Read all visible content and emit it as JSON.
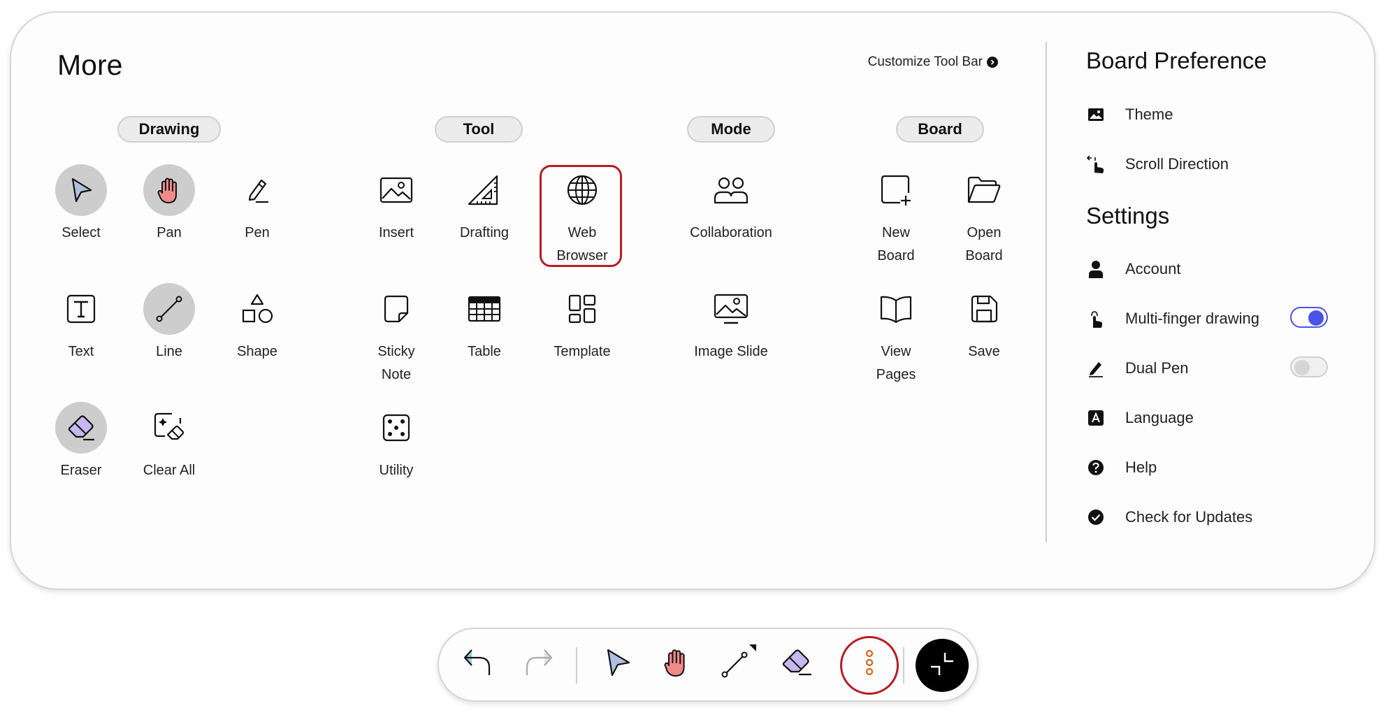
{
  "more_panel": {
    "title": "More",
    "customize_label": "Customize Tool Bar",
    "groups": {
      "drawing": "Drawing",
      "tool": "Tool",
      "mode": "Mode",
      "board": "Board"
    },
    "tools": {
      "select": "Select",
      "pan": "Pan",
      "pen": "Pen",
      "text": "Text",
      "line": "Line",
      "shape": "Shape",
      "eraser": "Eraser",
      "clear_all": "Clear All",
      "insert": "Insert",
      "drafting": "Drafting",
      "web_browser_1": "Web",
      "web_browser_2": "Browser",
      "sticky_note_1": "Sticky",
      "sticky_note_2": "Note",
      "table": "Table",
      "template": "Template",
      "utility": "Utility",
      "collaboration": "Collaboration",
      "image_slide": "Image Slide",
      "new_board_1": "New",
      "new_board_2": "Board",
      "open_board_1": "Open",
      "open_board_2": "Board",
      "view_pages_1": "View",
      "view_pages_2": "Pages",
      "save": "Save"
    },
    "selected_tools": [
      "select",
      "pan",
      "line",
      "eraser"
    ],
    "highlighted_tool": "web-browser"
  },
  "side_panel": {
    "board_preference_title": "Board Preference",
    "theme": "Theme",
    "scroll_direction": "Scroll Direction",
    "settings_title": "Settings",
    "account": "Account",
    "multi_finger": "Multi-finger drawing",
    "multi_finger_on": true,
    "dual_pen": "Dual Pen",
    "dual_pen_on": false,
    "language": "Language",
    "help": "Help",
    "check_updates": "Check for Updates"
  },
  "bottom_toolbar": {
    "buttons": [
      "undo-icon",
      "redo-icon",
      "select-icon",
      "pan-icon",
      "line-icon",
      "eraser-icon",
      "more-icon",
      "collapse-icon"
    ],
    "highlighted": "more-button"
  },
  "colors": {
    "accent": "#4b52e8",
    "highlight": "#b81c25",
    "select_fill": "#aebfe0",
    "pan_fill": "#f08a8a",
    "eraser_fill": "#c5b7ef",
    "selected_bg": "#cdcdcd"
  }
}
